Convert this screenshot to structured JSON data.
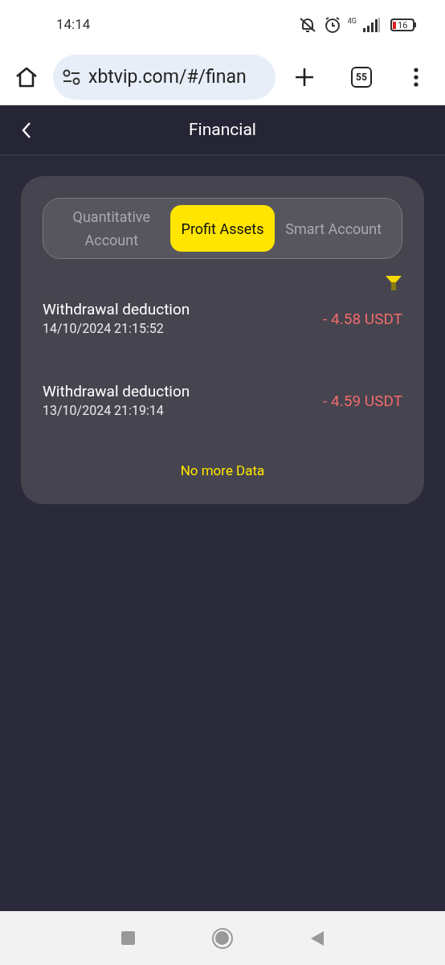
{
  "status_bar": {
    "time": "14:14",
    "network": "4G",
    "battery": "16"
  },
  "browser": {
    "url": "xbtvip.com/#/finan",
    "tab_count": "55"
  },
  "header": {
    "title": "Financial"
  },
  "tabs": [
    {
      "label": "Quantitative Account",
      "selected": false
    },
    {
      "label": "Profit Assets",
      "selected": true
    },
    {
      "label": "Smart Account",
      "selected": false
    }
  ],
  "records": [
    {
      "title": "Withdrawal deduction",
      "time": "14/10/2024 21:15:52",
      "amount": "- 4.58 USDT"
    },
    {
      "title": "Withdrawal deduction",
      "time": "13/10/2024 21:19:14",
      "amount": "- 4.59 USDT"
    }
  ],
  "footer_note": "No more Data"
}
